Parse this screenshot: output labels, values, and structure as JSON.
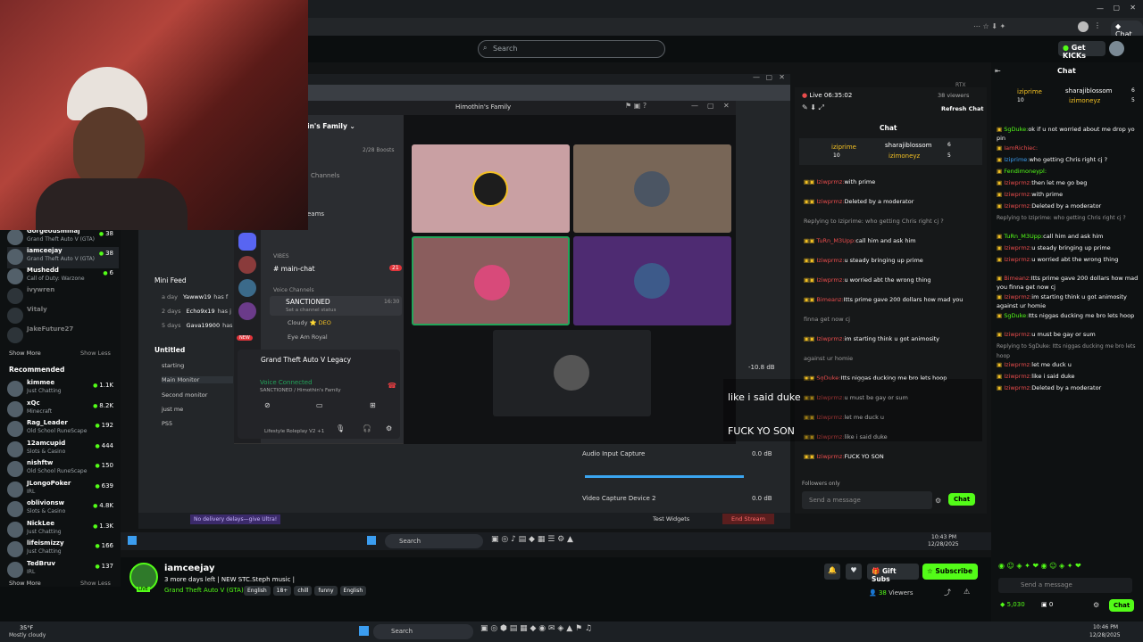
{
  "browser": {
    "search_placeholder": "Search",
    "get_kicks": "Get KICKs",
    "chat_tab": "Chat"
  },
  "streamers": [
    {
      "name": "Gorgeousminaj",
      "game": "Grand Theft Auto V (GTA)",
      "viewers": "38"
    },
    {
      "name": "iamceejay",
      "game": "Grand Theft Auto V (GTA)",
      "viewers": "38"
    },
    {
      "name": "Mushedd",
      "game": "Call of Duty: Warzone",
      "viewers": "6"
    },
    {
      "name": "ivywren",
      "game": "",
      "viewers": ""
    },
    {
      "name": "Vitaly",
      "game": "",
      "viewers": ""
    },
    {
      "name": "JakeFuture27",
      "game": "",
      "viewers": ""
    }
  ],
  "show_more": "Show More",
  "show_less": "Show Less",
  "recommended": "Recommended",
  "recommended_list": [
    {
      "name": "kimmee",
      "game": "Just Chatting",
      "viewers": "1.1K"
    },
    {
      "name": "xQc",
      "game": "Minecraft",
      "viewers": "8.2K"
    },
    {
      "name": "Rag_Leader",
      "game": "Old School RuneScape",
      "viewers": "192"
    },
    {
      "name": "12amcupid",
      "game": "Slots & Casino",
      "viewers": "444"
    },
    {
      "name": "nishftw",
      "game": "Old School RuneScape",
      "viewers": "150"
    },
    {
      "name": "JLongoPoker",
      "game": "IRL",
      "viewers": "639"
    },
    {
      "name": "oblivionsw",
      "game": "Slots & Casino",
      "viewers": "4.8K"
    },
    {
      "name": "NickLee",
      "game": "Just Chatting",
      "viewers": "1.3K"
    },
    {
      "name": "lifeismizzy",
      "game": "Just Chatting",
      "viewers": "166"
    },
    {
      "name": "TedBruv",
      "game": "IRL",
      "viewers": "137"
    }
  ],
  "discord": {
    "title": "Himothin's Family",
    "server": "in's Family",
    "boosts": "2/28 Boosts",
    "channels_label": "Channels",
    "streams": "eams",
    "vibes": "VIBES",
    "main_chat": "main-chat",
    "main_chat_badge": "21",
    "voice_channels": "Voice Channels",
    "sanctioned": "SANCTIONED",
    "sanctioned_time": "16:30",
    "set_status": "Set a channel status",
    "cloudy": "Cloudy",
    "deo": "DEO",
    "eye_am_royal": "Eye Am Royal",
    "gta_legacy": "Grand Theft Auto V Legacy",
    "voice_connected": "Voice Connected",
    "vc_sub": "SANCTIONED / Himothin's Family",
    "footer_game": "Lifestyle Roleplay V2 +1",
    "new": "NEW"
  },
  "mini_feed": {
    "title": "Mini Feed",
    "rows": [
      {
        "when": "a day",
        "who": "Yawww19",
        "txt": "has f"
      },
      {
        "when": "2 days",
        "who": "Echo9x19",
        "txt": "has j"
      },
      {
        "when": "5 days",
        "who": "Gava19900",
        "txt": "has"
      }
    ]
  },
  "scenes": {
    "title": "Untitled",
    "items": [
      "starting",
      "Main Monitor",
      "Second monitor",
      "just me",
      "PS5"
    ]
  },
  "obs": {
    "audio_input": "Audio Input Capture",
    "video_capture": "Video Capture Device 2",
    "db": "0.0 dB",
    "db2": "-10.8 dB",
    "no_delay": "No delivery delays—give Ultra!",
    "test_widgets": "Test Widgets",
    "end_stream": "End Stream"
  },
  "dashboard": {
    "live": "Live 06:35:02",
    "viewers_lbl": "38 viewers",
    "refresh": "Refresh Chat",
    "chat": "Chat",
    "rtx": "RTX",
    "top1": "iziprime",
    "top1_n": "10",
    "top2": "sharajiblossom",
    "top2_n": "6",
    "top3": "izimoneyz",
    "top3_n": "5",
    "followers_only": "Followers only",
    "send_placeholder": "Send a message",
    "chat_btn": "Chat"
  },
  "nested_chat": [
    {
      "user": "Iziwprmz:",
      "msg": "with prime"
    },
    {
      "user": "Iziwprmz:",
      "msg": "Deleted by a moderator"
    },
    {
      "user": "",
      "msg": "Replying to Iziprime: who getting Chris right cj ?"
    },
    {
      "user": "TuRn_M3Upp:",
      "msg": "call him and ask him"
    },
    {
      "user": "Iziwprmz:",
      "msg": "u steady bringing up prime"
    },
    {
      "user": "Iziwprmz:",
      "msg": "u worried abt the wrong thing"
    },
    {
      "user": "Bimeanz:",
      "msg": "Itts prime gave 200 dollars how mad you"
    },
    {
      "user": "",
      "msg": "finna get now cj"
    },
    {
      "user": "Iziwprmz:",
      "msg": "im starting think u got animosity"
    },
    {
      "user": "",
      "msg": "against ur homie"
    },
    {
      "user": "SgDuke:",
      "msg": "Itts niggas ducking me bro lets hoop"
    },
    {
      "user": "Iziwprmz:",
      "msg": "u must be gay or sum"
    },
    {
      "user": "Iziwprmz:",
      "msg": "let me duck u"
    },
    {
      "user": "Iziwprmz:",
      "msg": "like i said duke"
    },
    {
      "user": "Iziwprmz:",
      "msg": "FUCK YO SON"
    }
  ],
  "overlay": {
    "line1": "like i said duke",
    "line2": "FUCK YO SON"
  },
  "right_chat": [
    {
      "user": "SgDuke:",
      "msg": "ok if u not worried about me drop yo pin"
    },
    {
      "user": "IamRichiec:",
      "msg": ""
    },
    {
      "user": "Iziprime:",
      "msg": "who getting Chris right cj ?"
    },
    {
      "user": "Fendimoneypl:",
      "msg": ""
    },
    {
      "user": "Iziwprmz:",
      "msg": "then let me go beg"
    },
    {
      "user": "Iziwprmz:",
      "msg": "with prime"
    },
    {
      "user": "Iziwprmz:",
      "msg": "Deleted by a moderator"
    },
    {
      "user": "",
      "msg": "Replying to Iziprime: who getting Chris right cj ?"
    },
    {
      "user": "TuRn_M3Upp:",
      "msg": "call him and ask him"
    },
    {
      "user": "Iziwprmz:",
      "msg": "u steady bringing up prime"
    },
    {
      "user": "Iziwprmz:",
      "msg": "u worried abt the wrong thing"
    },
    {
      "user": "Bimeanz:",
      "msg": "Itts prime gave 200 dollars how mad you finna get now cj"
    },
    {
      "user": "Iziwprmz:",
      "msg": "im starting think u got animosity against ur homie"
    },
    {
      "user": "SgDuke:",
      "msg": "Itts niggas ducking me bro lets hoop"
    },
    {
      "user": "Iziwprmz:",
      "msg": "u must be gay or sum"
    },
    {
      "user": "",
      "msg": "Replying to SgDuke: Itts niggas ducking me bro lets hoop"
    },
    {
      "user": "Iziwprmz:",
      "msg": "let me duck u"
    },
    {
      "user": "Iziwprmz:",
      "msg": "like i said duke"
    },
    {
      "user": "Iziwprmz:",
      "msg": "Deleted by a moderator"
    }
  ],
  "right_panel": {
    "chat": "Chat",
    "top1": "iziprime",
    "top1_n": "10",
    "top2": "sharajiblossom",
    "top2_n": "6",
    "top3": "izimoneyz",
    "top3_n": "5",
    "send_placeholder": "Send a message",
    "kicks": "5,030",
    "zero": "0",
    "chat_btn": "Chat"
  },
  "stream_info": {
    "name": "iamceejay",
    "title": "3 more days left | NEW STC.Steph music |",
    "category": "Grand Theft Auto V (GTA)",
    "tags": [
      "English",
      "18+",
      "chill",
      "funny",
      "English"
    ],
    "viewers": "38",
    "viewers_lbl": "Viewers",
    "gift": "Gift Subs",
    "subscribe": "Subscribe",
    "live": "LIVE"
  },
  "inner_taskbar": {
    "search": "Search",
    "time": "10:43 PM",
    "date": "12/28/2025"
  },
  "taskbar": {
    "temp": "35°F",
    "weather": "Mostly cloudy",
    "search": "Search",
    "time": "10:46 PM",
    "date": "12/28/2025"
  }
}
